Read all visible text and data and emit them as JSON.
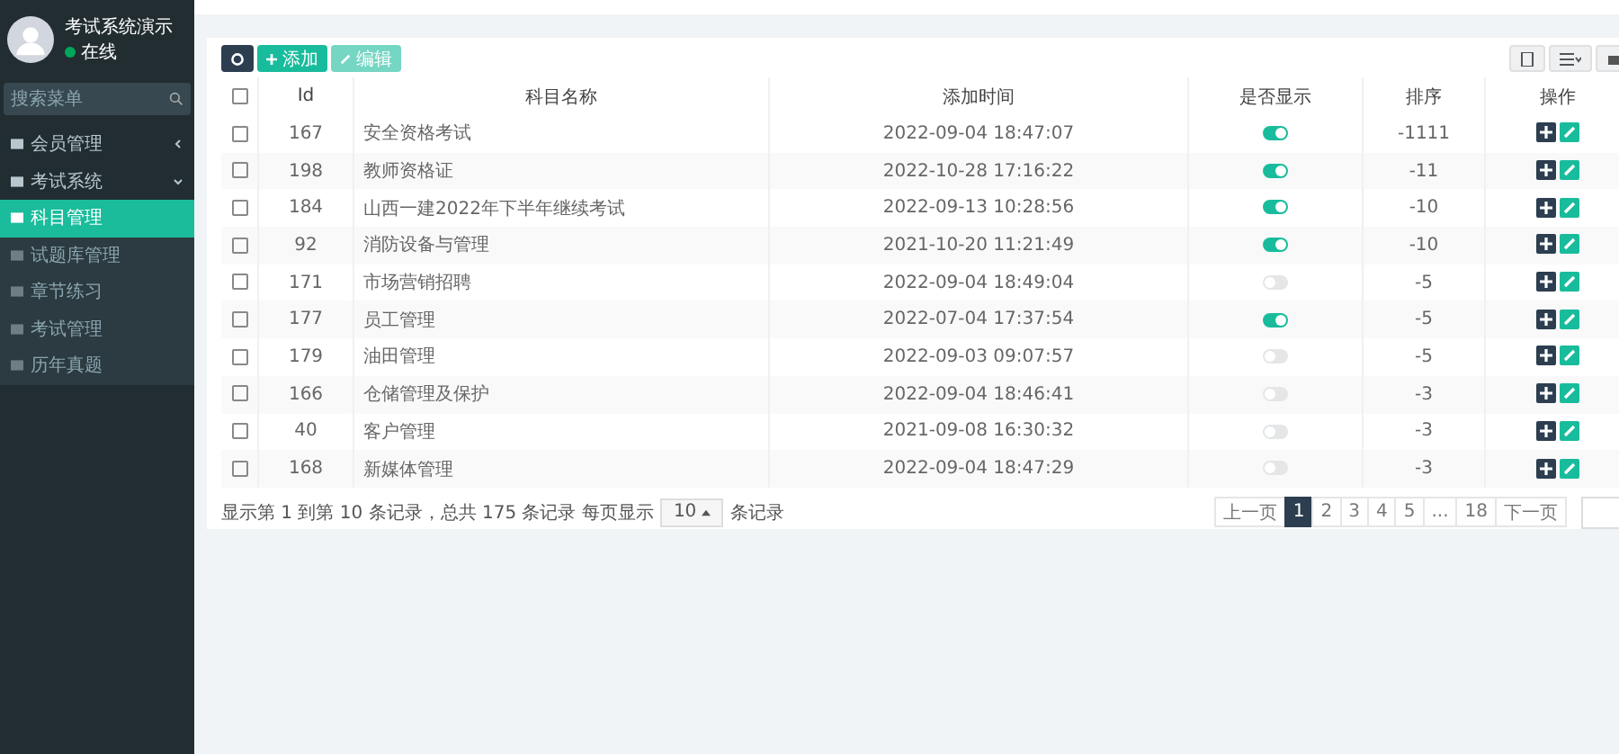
{
  "user": {
    "name": "考试系统演示",
    "status": "在线"
  },
  "sidebar": {
    "search_placeholder": "搜索菜单",
    "items": [
      {
        "label": "会员管理",
        "expanded": false,
        "selected": false
      },
      {
        "label": "考试系统",
        "expanded": true,
        "selected": false,
        "children": [
          {
            "label": "科目管理",
            "selected": true
          },
          {
            "label": "试题库管理",
            "selected": false
          },
          {
            "label": "章节练习",
            "selected": false
          },
          {
            "label": "考试管理",
            "selected": false
          },
          {
            "label": "历年真题",
            "selected": false
          }
        ]
      }
    ]
  },
  "toolbar": {
    "add": "添加",
    "edit": "编辑"
  },
  "table": {
    "all_checked": false,
    "columns": [
      "Id",
      "科目名称",
      "添加时间",
      "是否显示",
      "排序",
      "操作"
    ],
    "rows": [
      {
        "checked": false,
        "id": "167",
        "name": "安全资格考试",
        "time": "2022-09-04 18:47:07",
        "shown": true,
        "sort": "-1111"
      },
      {
        "checked": false,
        "id": "198",
        "name": "教师资格证",
        "time": "2022-10-28 17:16:22",
        "shown": true,
        "sort": "-11"
      },
      {
        "checked": false,
        "id": "184",
        "name": "山西一建2022年下半年继续考试",
        "time": "2022-09-13 10:28:56",
        "shown": true,
        "sort": "-10"
      },
      {
        "checked": false,
        "id": "92",
        "name": "消防设备与管理",
        "time": "2021-10-20 11:21:49",
        "shown": true,
        "sort": "-10"
      },
      {
        "checked": false,
        "id": "171",
        "name": "市场营销招聘",
        "time": "2022-09-04 18:49:04",
        "shown": false,
        "sort": "-5"
      },
      {
        "checked": false,
        "id": "177",
        "name": "员工管理",
        "time": "2022-07-04 17:37:54",
        "shown": true,
        "sort": "-5"
      },
      {
        "checked": false,
        "id": "179",
        "name": "油田管理",
        "time": "2022-09-03 09:07:57",
        "shown": false,
        "sort": "-5"
      },
      {
        "checked": false,
        "id": "166",
        "name": "仓储管理及保护",
        "time": "2022-09-04 18:46:41",
        "shown": false,
        "sort": "-3"
      },
      {
        "checked": false,
        "id": "40",
        "name": "客户管理",
        "time": "2021-09-08 16:30:32",
        "shown": false,
        "sort": "-3"
      },
      {
        "checked": false,
        "id": "168",
        "name": "新媒体管理",
        "time": "2022-09-04 18:47:29",
        "shown": false,
        "sort": "-3"
      }
    ]
  },
  "footer": {
    "summary": "显示第 1 到第 10 条记录，总共 175 条记录 每页显示",
    "page_size": "10",
    "suffix": "条记录"
  },
  "pagination": {
    "prev": "上一页",
    "pages": [
      {
        "label": "1",
        "selected": true
      },
      {
        "label": "2",
        "selected": false
      },
      {
        "label": "3",
        "selected": false
      },
      {
        "label": "4",
        "selected": false
      },
      {
        "label": "5",
        "selected": false
      },
      {
        "label": "...",
        "selected": false
      },
      {
        "label": "18",
        "selected": false
      }
    ],
    "next": "下一页"
  }
}
